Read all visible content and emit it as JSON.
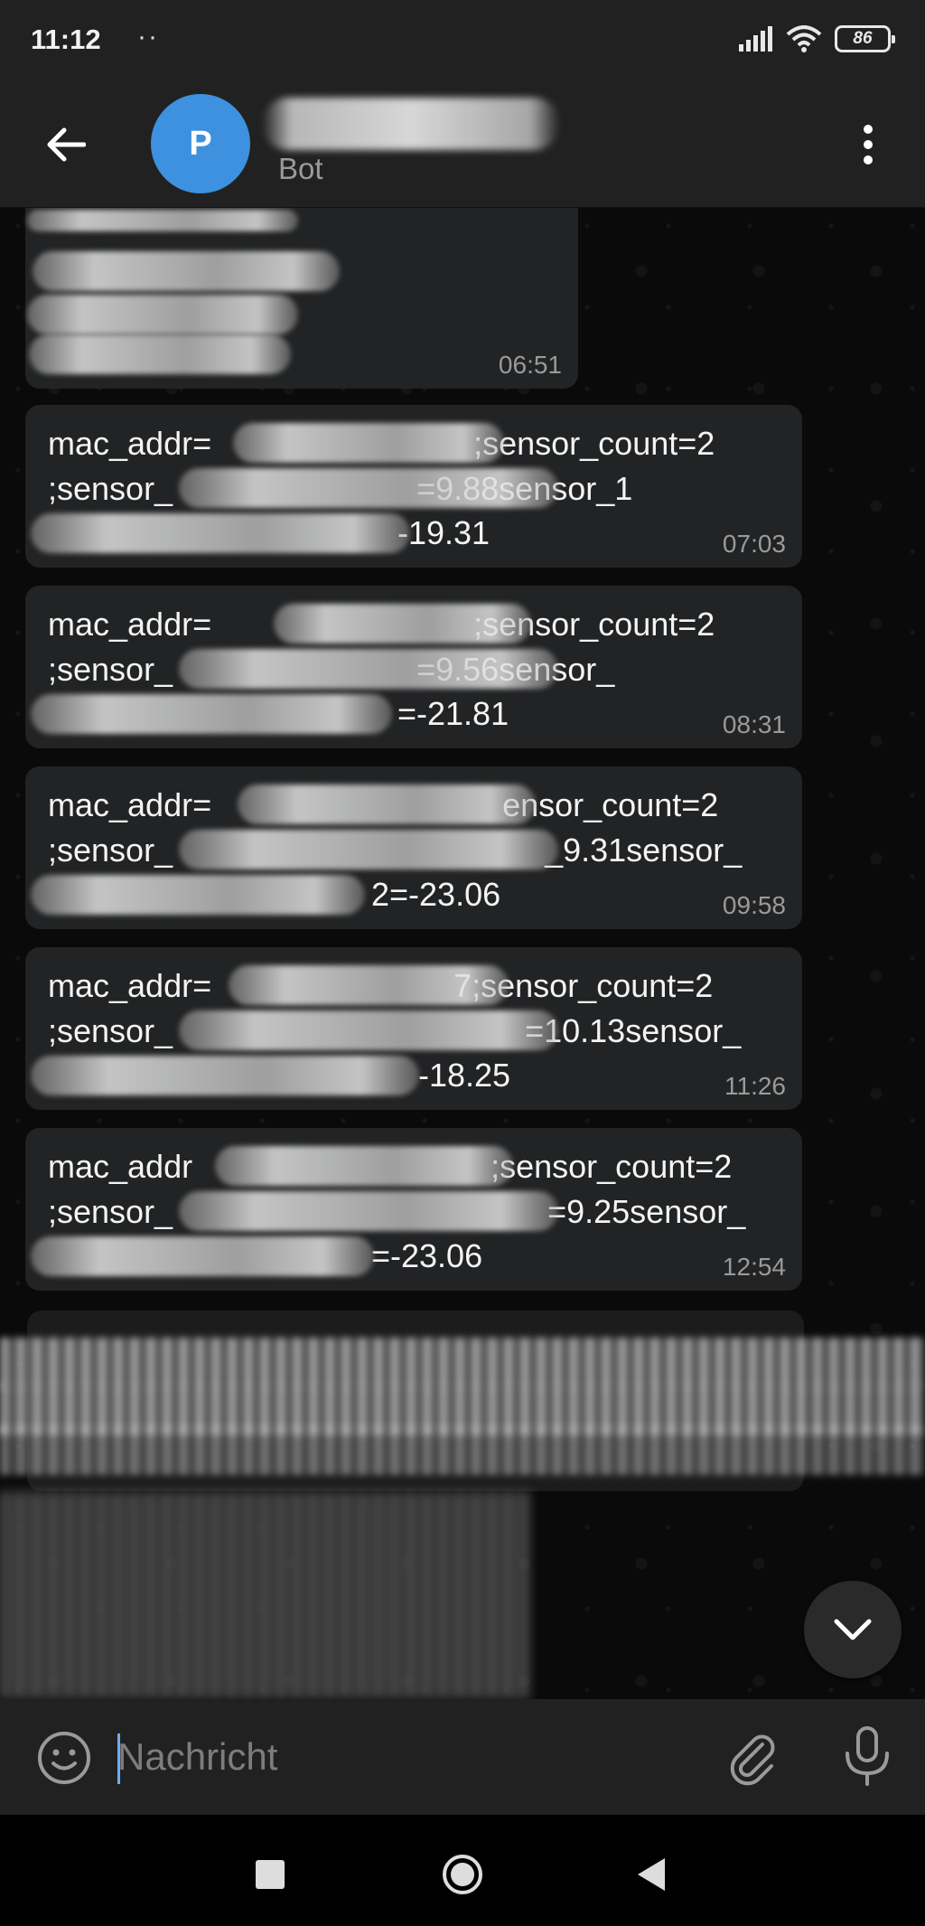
{
  "status_bar": {
    "time": "11:12",
    "dots": "··",
    "battery": "86"
  },
  "header": {
    "avatar_letter": "P",
    "subtitle": "Bot"
  },
  "messages": [
    {
      "id": 0,
      "time": "06:51"
    },
    {
      "id": 1,
      "line1a": "mac_addr=",
      "line1b": ";sensor_count=2",
      "line2a": ";sensor_",
      "line2b": "=9.88sensor_1",
      "line3b": "-19.31",
      "time": "07:03"
    },
    {
      "id": 2,
      "line1a": "mac_addr=",
      "line1b": ";sensor_count=2",
      "line2a": ";sensor_",
      "line2b": "=9.56sensor_",
      "line3b": "=-21.81",
      "time": "08:31"
    },
    {
      "id": 3,
      "line1a": "mac_addr=",
      "line1b": "ensor_count=2",
      "line2a": ";sensor_",
      "line2b": "_9.31sensor_",
      "line3b": "2=-23.06",
      "time": "09:58"
    },
    {
      "id": 4,
      "line1a": "mac_addr=",
      "line1b": "7;sensor_count=2",
      "line2a": ";sensor_",
      "line2b": "=10.13sensor_",
      "line3b": "-18.25",
      "time": "11:26"
    },
    {
      "id": 5,
      "line1a": "mac_addr",
      "line1b": ";sensor_count=2",
      "line2a": ";sensor_",
      "line2b": "=9.25sensor_",
      "line3b": "=-23.06",
      "time": "12:54"
    }
  ],
  "input": {
    "placeholder": "Nachricht"
  },
  "colors": {
    "avatar": "#3d91de",
    "bubble": "#222324",
    "bar": "#212121",
    "accent": "#6aaef0"
  },
  "icons": [
    "back-arrow-icon",
    "more-vert-icon",
    "chevron-down-icon",
    "emoji-icon",
    "paperclip-icon",
    "microphone-icon",
    "nav-recent-icon",
    "nav-home-icon",
    "nav-back-icon",
    "signal-icon",
    "wifi-icon",
    "battery-icon"
  ]
}
